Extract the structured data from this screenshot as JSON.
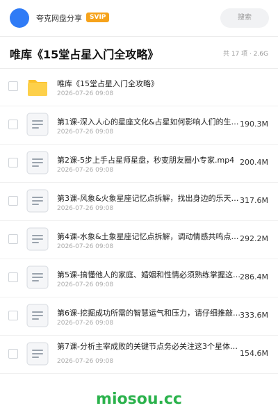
{
  "header": {
    "app_name": "夸克网盘分享",
    "badge": "SVIP",
    "search_placeholder": "搜索"
  },
  "title_bar": {
    "title": "唯库《15堂占星入门全攻略》",
    "summary": "共 17 项 · 2.6G"
  },
  "files": [
    {
      "type": "folder",
      "name": "唯库《15堂占星入门全攻略》",
      "date": "2026-07-26 09:08",
      "size": ""
    },
    {
      "type": "file",
      "name": "第1课-深入人心的星座文化&占星如何影响人们的生活…",
      "date": "2026-07-26 09:08",
      "size": "190.3M"
    },
    {
      "type": "file",
      "name": "第2课-5步上手占星师星盘，秒变朋友圈小专家.mp4",
      "date": "2026-07-26 09:08",
      "size": "200.4M"
    },
    {
      "type": "file",
      "name": "第3课-风象&火象星座记忆点拆解，找出身边的乐天派…",
      "date": "2026-07-26 09:08",
      "size": "317.6M"
    },
    {
      "type": "file",
      "name": "第4课-水象&土象星座记忆点拆解，调动情感共鸣点，…",
      "date": "2026-07-26 09:08",
      "size": "292.2M"
    },
    {
      "type": "file",
      "name": "第5课-搞懂他人的家庭、婚姻和性情必须熟练掌握这4…",
      "date": "2026-07-26 09:08",
      "size": "286.4M"
    },
    {
      "type": "file",
      "name": "第6课-挖掘成功所需的智慧运气和压力，请仔细推敲这…",
      "date": "2026-07-26 09:08",
      "size": "333.6M"
    },
    {
      "type": "file",
      "name": "第7课-分析主宰成败的关键节点务必关注这3个星体…",
      "date": "2026-07-26 09:08",
      "size": "154.6M"
    }
  ],
  "watermark": "miosou.cc",
  "colors": {
    "accent": "#2f7bf6",
    "badge": "#f6a31b",
    "folder": "#fbc22d",
    "watermark": "#2bb24c"
  }
}
